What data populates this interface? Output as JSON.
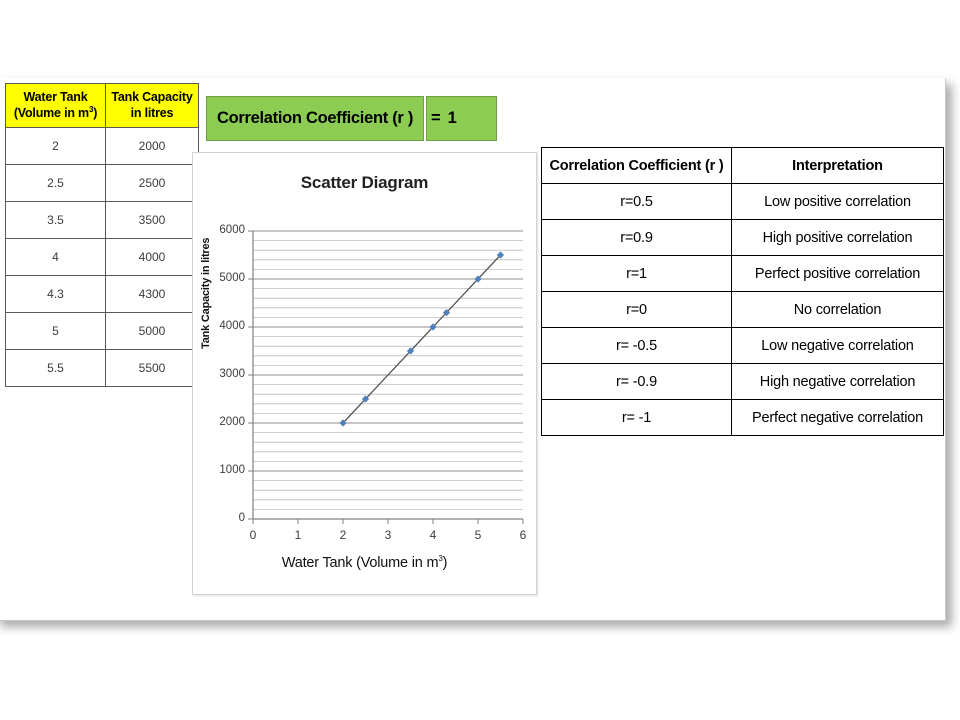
{
  "data_table": {
    "headers": [
      {
        "line1": "Water Tank",
        "line2_pre": "(Volume in m",
        "line2_sup": "3",
        "line2_post": ")"
      },
      {
        "line1": "Tank Capacity",
        "line2_pre": "in litres",
        "line2_sup": "",
        "line2_post": ""
      }
    ],
    "rows": [
      {
        "volume": "2",
        "capacity": "2000"
      },
      {
        "volume": "2.5",
        "capacity": "2500"
      },
      {
        "volume": "3.5",
        "capacity": "3500"
      },
      {
        "volume": "4",
        "capacity": "4000"
      },
      {
        "volume": "4.3",
        "capacity": "4300"
      },
      {
        "volume": "5",
        "capacity": "5000"
      },
      {
        "volume": "5.5",
        "capacity": "5500"
      }
    ],
    "header_bg": "#ffff00"
  },
  "correlation_banner": {
    "label": "Correlation Coefficient (r )",
    "equals": "=",
    "value": "1",
    "bg": "#8ccc52",
    "border": "#6f9f3f"
  },
  "chart_data": {
    "type": "scatter",
    "title": "Scatter Diagram",
    "xlabel_pre": "Water Tank (Volume in m",
    "xlabel_sup": "3",
    "xlabel_post": ")",
    "ylabel": "Tank Capacity in litres",
    "x": [
      2,
      2.5,
      3.5,
      4,
      4.3,
      5,
      5.5
    ],
    "y": [
      2000,
      2500,
      3500,
      4000,
      4300,
      5000,
      5500
    ],
    "xlim": [
      0,
      6
    ],
    "ylim": [
      0,
      6000
    ],
    "xticks": [
      0,
      1,
      2,
      3,
      4,
      5,
      6
    ],
    "yticks": [
      0,
      1000,
      2000,
      3000,
      4000,
      5000,
      6000
    ],
    "minor_y_step": 200,
    "grid": "horizontal",
    "legend": "none",
    "marker_color": "#4f81bd",
    "line_color": "#595959"
  },
  "interpretation_table": {
    "headers": [
      "Correlation Coefficient (r )",
      "Interpretation"
    ],
    "rows": [
      {
        "r": "r=0.5",
        "meaning": "Low positive correlation"
      },
      {
        "r": "r=0.9",
        "meaning": "High positive correlation"
      },
      {
        "r": "r=1",
        "meaning": "Perfect positive correlation"
      },
      {
        "r": "r=0",
        "meaning": "No correlation"
      },
      {
        "r": "r= -0.5",
        "meaning": "Low negative correlation"
      },
      {
        "r": "r= -0.9",
        "meaning": "High negative correlation"
      },
      {
        "r": "r= -1",
        "meaning": "Perfect negative correlation"
      }
    ]
  }
}
